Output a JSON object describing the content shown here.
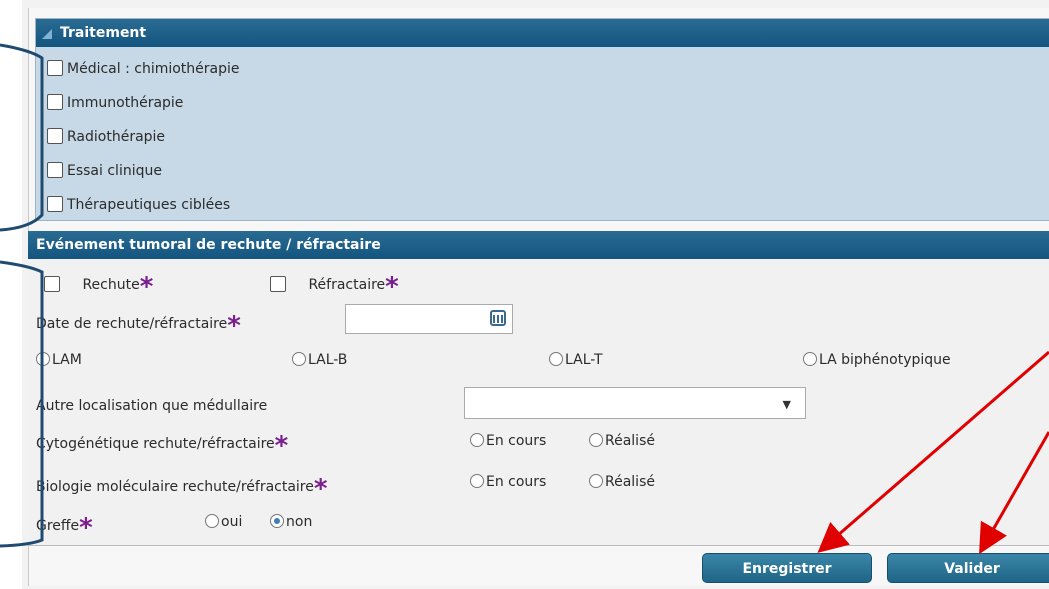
{
  "treatment": {
    "title": "Traitement",
    "options": [
      "Médical : chimiothérapie",
      "Immunothérapie",
      "Radiothérapie",
      "Essai clinique",
      "Thérapeutiques ciblées"
    ]
  },
  "relapse": {
    "title": "Evénement tumoral de rechute / réfractaire",
    "rechute_label": "Rechute",
    "refractaire_label": "Réfractaire",
    "date_label": "Date de rechute/réfractaire",
    "types": [
      "LAM",
      "LAL-B",
      "LAL-T",
      "LA biphénotypique"
    ],
    "autre_loc_label": "Autre localisation que médullaire",
    "cyto_label": "Cytogénétique rechute/réfractaire",
    "bio_label": "Biologie moléculaire rechute/réfractaire",
    "en_cours": "En cours",
    "realise": "Réalisé",
    "greffe_label": "Greffe",
    "oui": "oui",
    "non": "non",
    "greffe_selected": "non"
  },
  "required_mark": "*",
  "buttons": {
    "save": "Enregistrer",
    "validate": "Valider"
  },
  "colors": {
    "header": "#1a5e89",
    "panel": "#c7d8e6",
    "required": "#7a1f8e",
    "annotation": "#e00000",
    "bracket": "#1f4b70"
  },
  "icons": {
    "calendar": "calendar-icon",
    "dropdown": "chevron-down-icon",
    "collapse": "collapse-triangle-icon"
  }
}
